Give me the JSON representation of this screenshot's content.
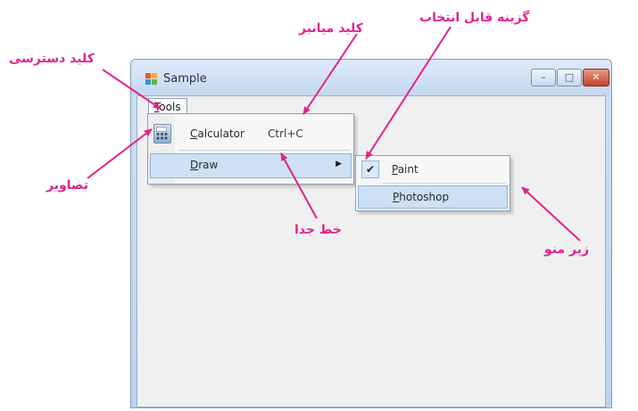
{
  "window": {
    "title": "Sample",
    "controls": {
      "minimize": "–",
      "maximize": "□",
      "close": "✕"
    },
    "colors": {
      "titlebar": "#c4d8ef",
      "client": "#f0f0f0",
      "close": "#c4432a"
    }
  },
  "menubar": {
    "tools": {
      "mnemonic": "T",
      "rest": "ools"
    }
  },
  "dropdown": {
    "items": [
      {
        "icon": "calculator-icon",
        "mnemonic": "C",
        "rest": "alculator",
        "shortcut": "Ctrl+C"
      },
      {
        "mnemonic": "D",
        "rest": "raw",
        "submenu_arrow": "▶",
        "highlighted": true
      }
    ]
  },
  "submenu": {
    "items": [
      {
        "checked": true,
        "check_glyph": "✔",
        "mnemonic": "P",
        "rest": "aint"
      },
      {
        "mnemonic": "P",
        "rest": "hotoshop",
        "highlighted": true
      }
    ]
  },
  "annotations": {
    "access_key": "کلید دسترسی",
    "shortcut_key": "کلید میانبر",
    "checkable_option": "گزینه قابل انتخاب",
    "images": "تصاویر",
    "separator_line": "خط جدا",
    "submenu": "زیر منو",
    "color": "#e0238f"
  }
}
